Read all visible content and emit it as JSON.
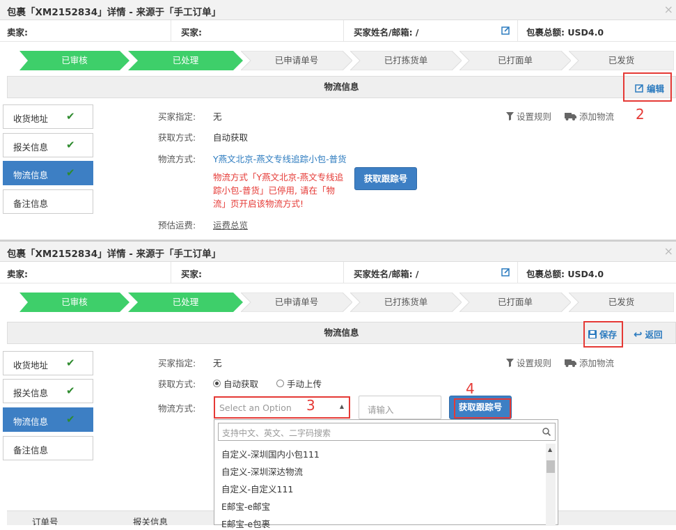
{
  "panel1": {
    "title": "包裹「XM2152834」详情 - 来源于「手工订单」",
    "close": "×",
    "info": {
      "seller_label": "卖家:",
      "buyer_label": "买家:",
      "buyer_name_email_label": "买家姓名/邮箱: /",
      "total_label": "包裹总额: USD4.0"
    },
    "steps": [
      "已审核",
      "已处理",
      "已申请单号",
      "已打拣货单",
      "已打面单",
      "已发货"
    ],
    "section_title": "物流信息",
    "edit_label": "编辑",
    "annotation": "2",
    "tabs": [
      "收货地址",
      "报关信息",
      "物流信息",
      "备注信息"
    ],
    "tools": {
      "rules": "设置规则",
      "add": "添加物流"
    },
    "fields": {
      "buyer_assign_label": "买家指定:",
      "buyer_assign_value": "无",
      "fetch_label": "获取方式:",
      "fetch_value": "自动获取",
      "method_label": "物流方式:",
      "method_value": "Y燕文北京-燕文专线追踪小包-普货",
      "warning": "物流方式「Y燕文北京-燕文专线追踪小包-普货」已停用, 请在「物流」页开启该物流方式!",
      "get_tracking": "获取跟踪号",
      "est_label": "预估运费:",
      "est_value": "运费总览"
    }
  },
  "panel2": {
    "title": "包裹「XM2152834」详情 - 来源于「手工订单」",
    "close": "×",
    "info": {
      "seller_label": "卖家:",
      "buyer_label": "买家:",
      "buyer_name_email_label": "买家姓名/邮箱: /",
      "total_label": "包裹总额: USD4.0"
    },
    "steps": [
      "已审核",
      "已处理",
      "已申请单号",
      "已打拣货单",
      "已打面单",
      "已发货"
    ],
    "section_title": "物流信息",
    "save_label": "保存",
    "back_label": "返回",
    "tabs": [
      "收货地址",
      "报关信息",
      "物流信息",
      "备注信息"
    ],
    "tools": {
      "rules": "设置规则",
      "add": "添加物流"
    },
    "fields": {
      "buyer_assign_label": "买家指定:",
      "buyer_assign_value": "无",
      "fetch_label": "获取方式:",
      "radio_auto": "自动获取",
      "radio_manual": "手动上传",
      "method_label": "物流方式:",
      "select_placeholder": "Select an Option",
      "annotation3": "3",
      "input_placeholder": "请输入",
      "get_tracking": "获取跟踪号",
      "annotation4": "4"
    },
    "dropdown": {
      "search_placeholder": "支持中文、英文、二字码搜索",
      "options": [
        "自定义-深圳国内小包111",
        "自定义-深圳深达物流",
        "自定义-自定义111",
        "E邮宝-e邮宝",
        "E邮宝-e包裹"
      ]
    },
    "bottom_headers": [
      "订单号",
      "报关信息"
    ]
  },
  "colors": {
    "step_done": "#3ecf6a",
    "step_pending": "#f0f0f0",
    "primary": "#3d7fc4",
    "highlight": "#e53935"
  }
}
